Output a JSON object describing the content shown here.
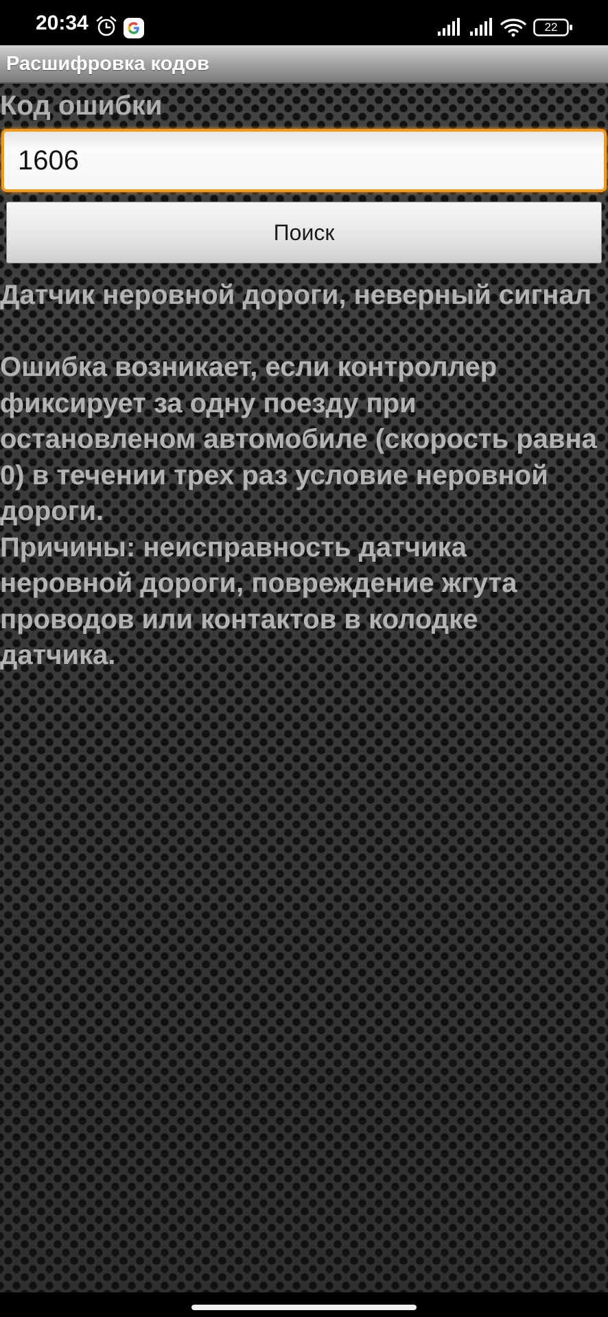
{
  "status_bar": {
    "time": "20:34",
    "battery_level": "22",
    "icons": [
      "alarm-icon",
      "google-icon",
      "signal-icon",
      "signal-icon",
      "wifi-icon",
      "battery-icon"
    ]
  },
  "action_bar": {
    "title": "Расшифровка кодов"
  },
  "form": {
    "label": "Код ошибки",
    "code_value": "1606",
    "search_label": "Поиск"
  },
  "result": {
    "title": "Датчик неровной дороги, неверный сигнал",
    "description": "Ошибка возникает, если контроллер фиксирует за одну поезду при остановленом автомобиле (скорость равна 0) в течении трех раз условие неровной дороги.",
    "causes": "Причины: неисправность датчика неровной дороги, повреждение жгута проводов или контактов в колодке датчика."
  },
  "colors": {
    "accent": "#f39a1c",
    "text": "#b3b3b3",
    "background": "#3c3c3c"
  }
}
